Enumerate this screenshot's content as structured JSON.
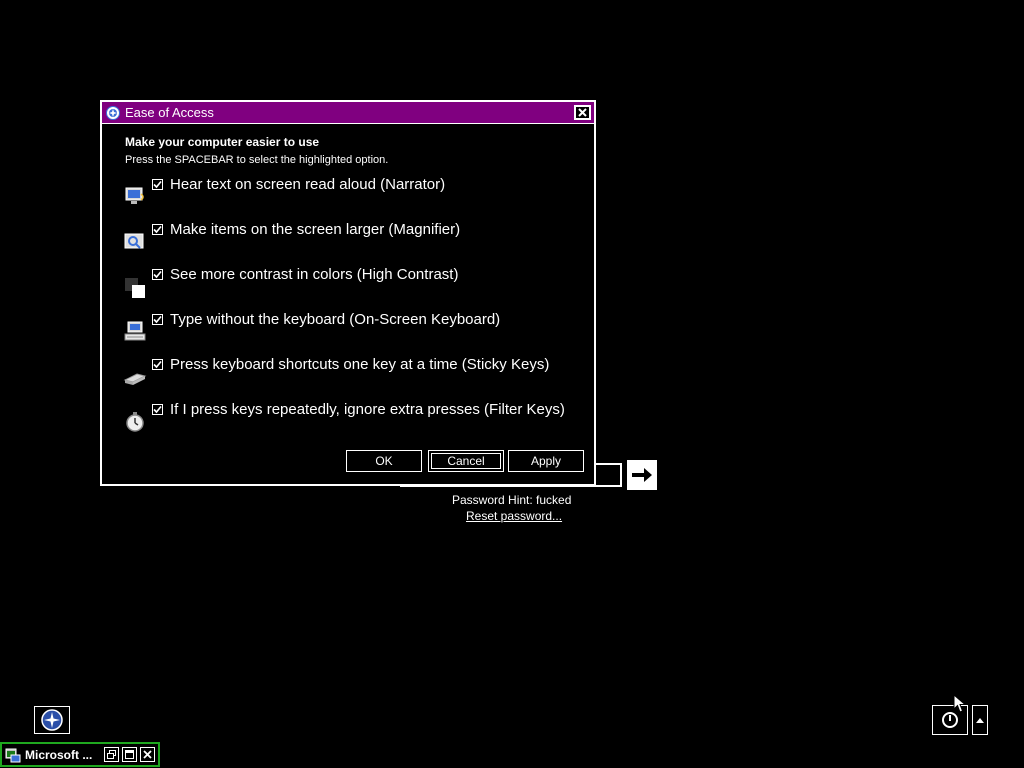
{
  "dialog": {
    "title": "Ease of Access",
    "heading": "Make your computer easier to use",
    "subheading": "Press the SPACEBAR to select the highlighted option.",
    "options": [
      {
        "label": "Hear text on screen read aloud (Narrator)",
        "checked": true,
        "icon": "narrator-icon"
      },
      {
        "label": "Make items on the screen larger (Magnifier)",
        "checked": true,
        "icon": "magnifier-icon"
      },
      {
        "label": "See more contrast in colors (High Contrast)",
        "checked": true,
        "icon": "high-contrast-icon"
      },
      {
        "label": "Type without the keyboard (On-Screen Keyboard)",
        "checked": true,
        "icon": "on-screen-keyboard-icon"
      },
      {
        "label": "Press keyboard shortcuts one key at a time (Sticky Keys)",
        "checked": true,
        "icon": "sticky-keys-icon"
      },
      {
        "label": "If I press keys repeatedly, ignore extra presses (Filter Keys)",
        "checked": true,
        "icon": "filter-keys-icon"
      }
    ],
    "buttons": {
      "ok": "OK",
      "cancel": "Cancel",
      "apply": "Apply"
    }
  },
  "login": {
    "password_hint": "Password Hint: fucked",
    "reset_password": "Reset password..."
  },
  "taskbar": {
    "label": "Microsoft ..."
  },
  "colors": {
    "titlebar": "#800080",
    "taskbar_border": "#1fa81f",
    "background": "#000000"
  }
}
